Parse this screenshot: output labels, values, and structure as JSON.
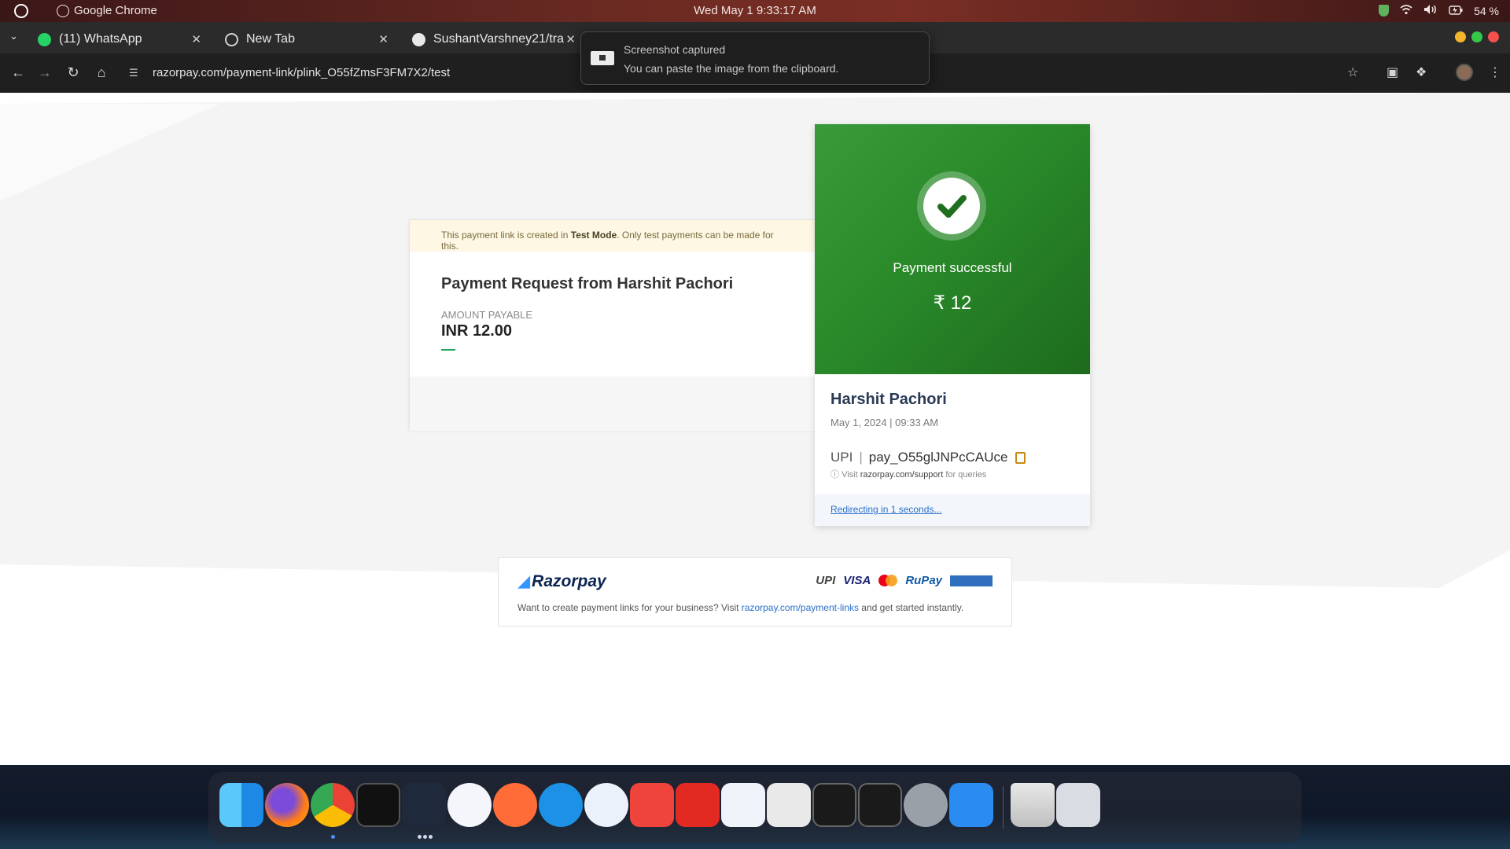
{
  "system_bar": {
    "app_name": "Google Chrome",
    "clock": "Wed May 1   9:33:17 AM",
    "battery": "54 %"
  },
  "tabs": [
    {
      "label": "(11) WhatsApp"
    },
    {
      "label": "New Tab"
    },
    {
      "label": "SushantVarshney21/tra"
    }
  ],
  "toolbar": {
    "url": "razorpay.com/payment-link/plink_O55fZmsF3FM7X2/test"
  },
  "toast": {
    "title": "Screenshot captured",
    "message": "You can paste the image from the clipboard."
  },
  "payment_request": {
    "test_notice_prefix": "This payment link is created in ",
    "test_notice_mode": "Test Mode",
    "test_notice_suffix": ". Only test payments can be made for this.",
    "title": "Payment Request from Harshit Pachori",
    "amount_label": "AMOUNT PAYABLE",
    "amount_value": "INR 12.00"
  },
  "receipt": {
    "status": "Payment successful",
    "amount": "₹ 12",
    "payer_name": "Harshit Pachori",
    "date": "May 1, 2024 | 09:33 AM",
    "method": "UPI",
    "payment_id": "pay_O55glJNPcCAUce",
    "support_prefix": "Visit ",
    "support_link": "razorpay.com/support",
    "support_suffix": " for queries",
    "redirect_text": "Redirecting in 1 seconds..."
  },
  "razorpay_footer": {
    "logo_text": "Razorpay",
    "payment_logos": [
      "UPI",
      "VISA",
      "RuPay"
    ],
    "text_prefix": "Want to create payment links for your business? Visit ",
    "text_link": "razorpay.com/payment-links",
    "text_suffix": " and get started instantly."
  },
  "dock": {
    "apps": [
      "Finder",
      "Firefox",
      "Chrome",
      "Terminal",
      "VS Code",
      "Xcode",
      "Postman",
      "Docker",
      "Thunderbird",
      "AnyDesk",
      "Acrobat",
      "Document Viewer",
      "Text Editor",
      "Activity Monitor",
      "Activity Monitor 2",
      "System Preferences",
      "App Store",
      "Trash",
      "Launchpad"
    ]
  },
  "colors": {
    "success_green": "#2a8a2a",
    "link_blue": "#2b6fc9",
    "test_banner": "#fdf7e4",
    "razorpay_navy": "#0c2451"
  }
}
